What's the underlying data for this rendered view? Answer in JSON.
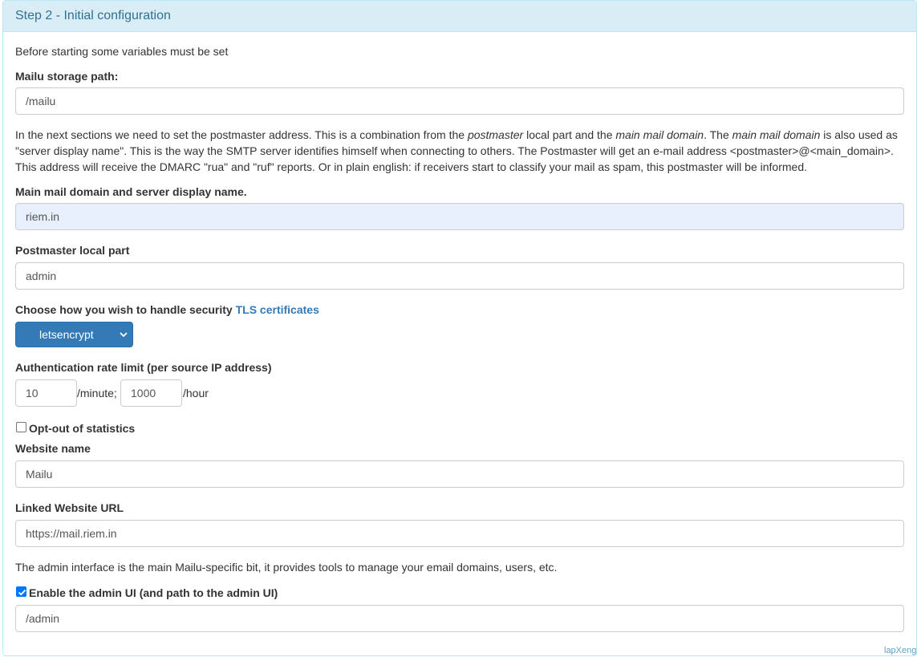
{
  "panel": {
    "title": "Step 2 - Initial configuration"
  },
  "intro": "Before starting some variables must be set",
  "storage": {
    "label": "Mailu storage path:",
    "value": "/mailu"
  },
  "postmaster_info": {
    "p1": "In the next sections we need to set the postmaster address. This is a combination from the ",
    "em1": "postmaster",
    "p2": " local part and the ",
    "em2": "main mail domain",
    "p3": ". The ",
    "em3": "main mail domain",
    "p4": " is also used as \"server display name\". This is the way the SMTP server identifies himself when connecting to others. The Postmaster will get an e-mail address <postmaster>@<main_domain>. This address will receive the DMARC \"rua\" and \"ruf\" reports. Or in plain english: if receivers start to classify your mail as spam, this postmaster will be informed."
  },
  "domain": {
    "label": "Main mail domain and server display name.",
    "value": "riem.in"
  },
  "postmaster": {
    "label": "Postmaster local part",
    "value": "admin"
  },
  "tls": {
    "label": "Choose how you wish to handle security",
    "link": "TLS certificates",
    "selected": "letsencrypt"
  },
  "rate_limit": {
    "label": "Authentication rate limit (per source IP address)",
    "per_minute": "10",
    "minute_unit": "/minute;",
    "per_hour": "1000",
    "hour_unit": "/hour"
  },
  "statistics": {
    "label": "Opt-out of statistics",
    "checked": false
  },
  "website_name": {
    "label": "Website name",
    "value": "Mailu"
  },
  "website_url": {
    "label": "Linked Website URL",
    "value": "https://mail.riem.in"
  },
  "admin_info": "The admin interface is the main Mailu-specific bit, it provides tools to manage your email domains, users, etc.",
  "admin_ui": {
    "label": "Enable the admin UI (and path to the admin UI)",
    "checked": true,
    "value": "/admin"
  },
  "watermark": "lapXeng",
  "colors": {
    "heading_bg": "#d9edf7",
    "heading_text": "#31708f",
    "link": "#337ab7",
    "select_bg": "#337ab7",
    "checkbox_checked": "#0075ff"
  }
}
